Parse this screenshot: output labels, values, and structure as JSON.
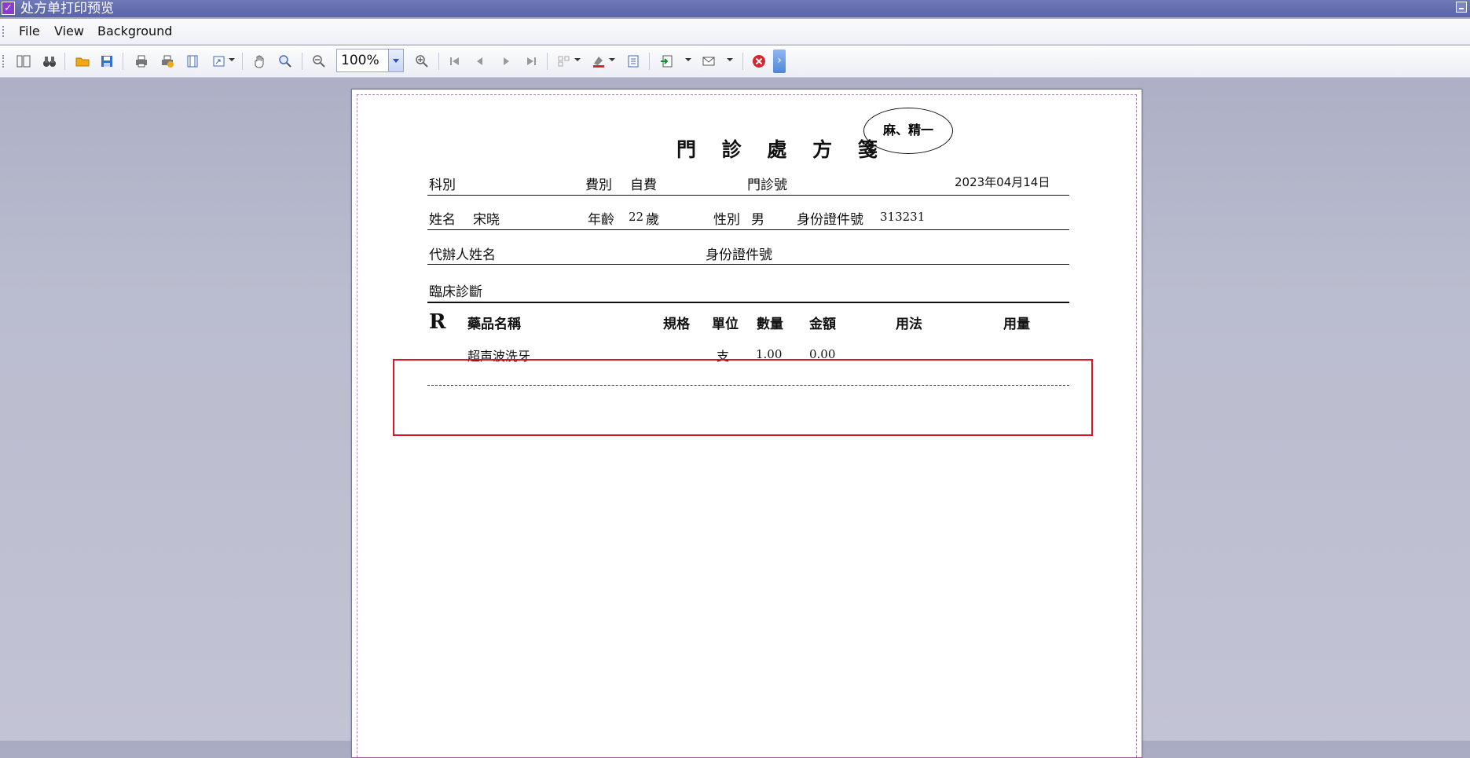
{
  "window": {
    "title": "处方单打印预览"
  },
  "menu": {
    "items": [
      "File",
      "View",
      "Background"
    ]
  },
  "toolbar": {
    "zoom_value": "100%"
  },
  "prescription": {
    "title": "門 診 處 方 箋",
    "stamp": "麻、精一",
    "row1": {
      "dept_label": "科別",
      "fee_label": "費別",
      "fee_value": "自費",
      "clinic_no_label": "門診號",
      "date": "2023年04月14日"
    },
    "row2": {
      "name_label": "姓名",
      "name_value": "宋晓",
      "age_label": "年齡",
      "age_value": "22",
      "age_unit": "歲",
      "sex_label": "性別",
      "sex_value": "男",
      "id_label": "身份證件號",
      "id_value": "313231"
    },
    "row3": {
      "agent_label": "代辦人姓名",
      "agent_id_label": "身份證件號"
    },
    "row4": {
      "diagnosis_label": "臨床診斷"
    },
    "table": {
      "rx_symbol": "R",
      "headers": [
        "藥品名稱",
        "規格",
        "單位",
        "數量",
        "金額",
        "用法",
        "用量"
      ],
      "rows": [
        {
          "name": "超声波洗牙",
          "spec": "",
          "unit": "支",
          "qty": "1.00",
          "amount": "0.00",
          "usage": "",
          "dosage": ""
        }
      ]
    }
  }
}
